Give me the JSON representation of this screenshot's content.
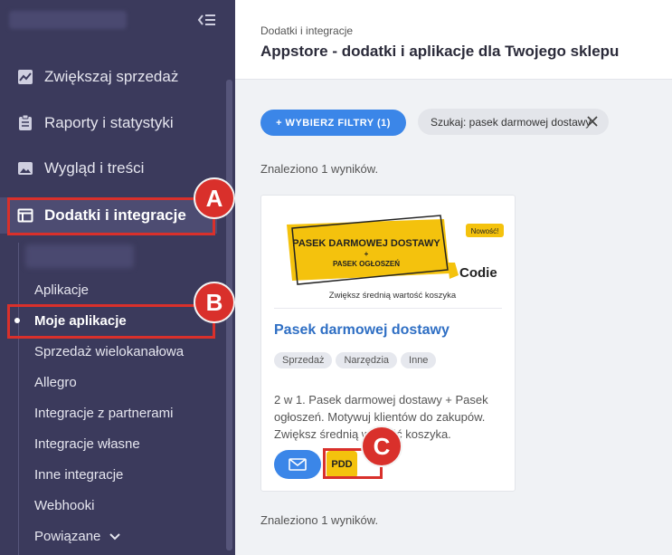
{
  "sidebar": {
    "nav": [
      {
        "label": "Zwiększaj sprzedaż",
        "icon": "chart-line-icon"
      },
      {
        "label": "Raporty i statystyki",
        "icon": "clipboard-icon"
      },
      {
        "label": "Wygląd i treści",
        "icon": "image-icon"
      },
      {
        "label": "Dodatki i integracje",
        "icon": "window-icon"
      }
    ],
    "sub": [
      {
        "label": "Aplikacje"
      },
      {
        "label": "Moje aplikacje"
      },
      {
        "label": "Sprzedaż wielokanałowa"
      },
      {
        "label": "Allegro"
      },
      {
        "label": "Integracje z partnerami"
      },
      {
        "label": "Integracje własne"
      },
      {
        "label": "Inne integracje"
      },
      {
        "label": "Webhooki"
      },
      {
        "label": "Powiązane"
      }
    ]
  },
  "markers": {
    "a": "A",
    "b": "B",
    "c": "C"
  },
  "header": {
    "breadcrumb": "Dodatki i integracje",
    "title": "Appstore - dodatki i aplikacje dla Twojego sklepu"
  },
  "filters": {
    "button_label": "+ WYBIERZ FILTRY (1)",
    "chip_label": "Szukaj: pasek darmowej dostawy"
  },
  "results": {
    "count_text": "Znaleziono 1 wyników."
  },
  "card": {
    "banner": {
      "line1": "PASEK DARMOWEJ DOSTAWY",
      "plus": "+",
      "line2": "PASEK OGŁOSZEŃ",
      "badge": "Nowość!",
      "brand": "Codie",
      "tagline": "Zwiększ średnią wartość koszyka"
    },
    "title": "Pasek darmowej dostawy",
    "tags": [
      "Sprzedaż",
      "Narzędzia",
      "Inne"
    ],
    "description": "2 w 1. Pasek darmowej dostawy + Pasek ogłoszeń. Motywuj klientów do zakupów. Zwiększ średnią wartość koszyka.",
    "pdd_label": "PDD"
  },
  "colors": {
    "sidebar": "#3b3a5c",
    "accent": "#3b86e8",
    "highlight": "#d9302b",
    "yellow": "#f4c20d"
  }
}
